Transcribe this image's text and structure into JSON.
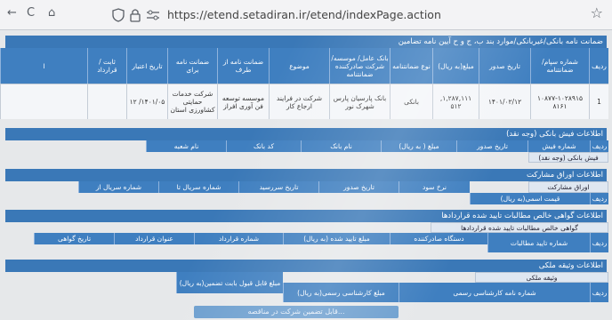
{
  "browser": {
    "url": "https://etend.setadiran.ir/etend/indexPage.action",
    "back": "←",
    "reload": "C",
    "home": "⌂"
  },
  "guarantee": {
    "title": "ضمانت نامه بانکی/غیربانکی/موارد بند ب، ج و ح آیین نامه تضامین",
    "headers": [
      "ردیف",
      "شماره سپام/ ضمانتنامه",
      "تاریخ صدور",
      "مبلغ(به ریال)",
      "نوع ضمانتنامه",
      "بانک عامل/ موسسه/ شرکت صادرکننده ضمانتنامه",
      "موضوع",
      "ضمانت نامه از طرف",
      "ضمانت نامه برای",
      "تاریخ اعتبار",
      "ثابت / قرارداد",
      "ا"
    ],
    "row": [
      "1",
      "۱۰۸۷۷-۱۰۲۸۹۱۵ ۸۱۶۱",
      "۱۴۰۱/۰۲/۱۲",
      "۱,۲۸۷,۱۱۱, ۵۱۲",
      "بانکی",
      "بانک پارسیان پارس شهرک نور",
      "شرکت در فرایند ارجاع کار",
      "موسسه توسعه فن آوری افراز",
      "شرکت خدمات حمایتی کشاورزی استان",
      "۱۴۰۱/۰۵/ ۱۲",
      "",
      ""
    ]
  },
  "cheque": {
    "title": "اطلاعات فیش بانکی (وجه نقد)",
    "headers": [
      "نام شعبه",
      "کد بانک",
      "نام بانک",
      "مبلغ ( به ریال)",
      "تاریخ صدور",
      "شماره فیش",
      "ردیف"
    ],
    "sub_title": "فیش بانکی (وجه نقد)"
  },
  "bonds": {
    "title": "اطلاعات اوراق مشارکت",
    "headers": [
      "شماره سریال از",
      "شماره سریال تا",
      "تاریخ سررسید",
      "تاریخ صدور",
      "نرخ سود",
      "قیمت اسمی(به ریال)",
      "ردیف"
    ],
    "sub_title": "اوراق مشارکت"
  },
  "certificate": {
    "title": "اطلاعات گواهی خالص مطالبات تایید شده قراردادها",
    "headers": [
      "تاریخ گواهی",
      "عنوان قرارداد",
      "شماره قرارداد",
      "مبلغ تایید شده (به ریال)",
      "دستگاه صادرکننده",
      "شماره تایید مطالبات",
      "ردیف"
    ],
    "sub_title": "گواهی خالص مطالبات تایید شده قراردادها"
  },
  "property": {
    "title": "اطلاعات وثیقه ملکی",
    "headers": [
      "مبلغ قابل قبول بابت تضمین(به ریال)",
      "مبلغ کارشناسی رسمی(به ریال)",
      "شماره نامه کارشناسی رسمی",
      "ردیف"
    ],
    "sub_title": "وثیقه ملکی"
  },
  "bottom_button": "...قابل تضمین شرکت در مناقصه"
}
